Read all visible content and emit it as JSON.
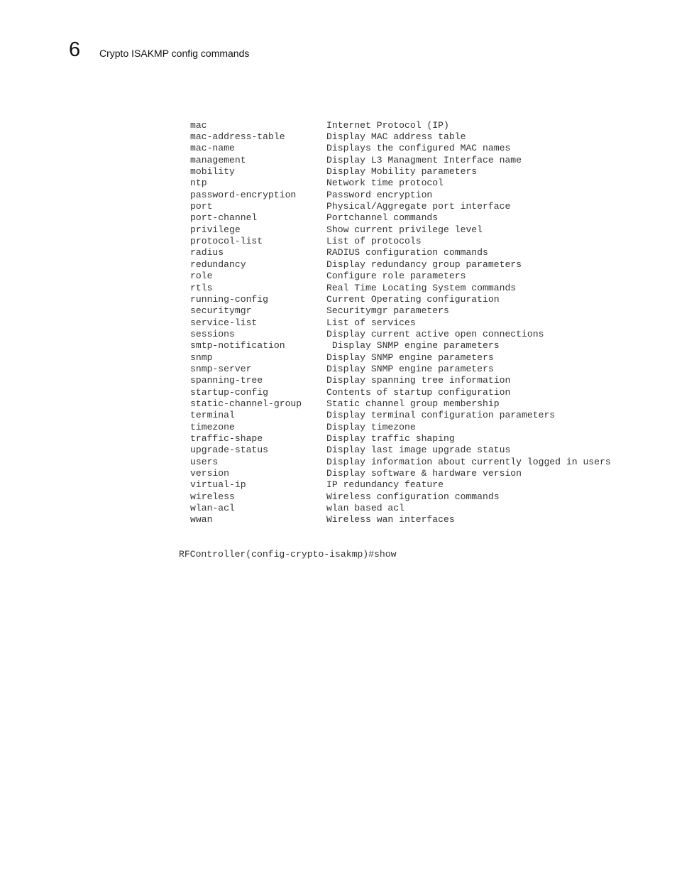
{
  "header": {
    "chapter_number": "6",
    "section_title": "Crypto ISAKMP config commands"
  },
  "cli": {
    "rows": [
      {
        "command": "mac",
        "description": "Internet Protocol (IP)"
      },
      {
        "command": "mac-address-table",
        "description": "Display MAC address table"
      },
      {
        "command": "mac-name",
        "description": "Displays the configured MAC names"
      },
      {
        "command": "management",
        "description": "Display L3 Managment Interface name"
      },
      {
        "command": "mobility",
        "description": "Display Mobility parameters"
      },
      {
        "command": "ntp",
        "description": "Network time protocol"
      },
      {
        "command": "password-encryption",
        "description": "Password encryption"
      },
      {
        "command": "port",
        "description": "Physical/Aggregate port interface"
      },
      {
        "command": "port-channel",
        "description": "Portchannel commands"
      },
      {
        "command": "privilege",
        "description": "Show current privilege level"
      },
      {
        "command": "protocol-list",
        "description": "List of protocols"
      },
      {
        "command": "radius",
        "description": "RADIUS configuration commands"
      },
      {
        "command": "redundancy",
        "description": "Display redundancy group parameters"
      },
      {
        "command": "role",
        "description": "Configure role parameters"
      },
      {
        "command": "rtls",
        "description": "Real Time Locating System commands"
      },
      {
        "command": "running-config",
        "description": "Current Operating configuration"
      },
      {
        "command": "securitymgr",
        "description": "Securitymgr parameters"
      },
      {
        "command": "service-list",
        "description": "List of services"
      },
      {
        "command": "sessions",
        "description": "Display current active open connections"
      },
      {
        "command": "smtp-notification",
        "description": " Display SNMP engine parameters"
      },
      {
        "command": "snmp",
        "description": "Display SNMP engine parameters"
      },
      {
        "command": "snmp-server",
        "description": "Display SNMP engine parameters"
      },
      {
        "command": "spanning-tree",
        "description": "Display spanning tree information"
      },
      {
        "command": "startup-config",
        "description": "Contents of startup configuration"
      },
      {
        "command": "static-channel-group",
        "description": "Static channel group membership"
      },
      {
        "command": "terminal",
        "description": "Display terminal configuration parameters"
      },
      {
        "command": "timezone",
        "description": "Display timezone"
      },
      {
        "command": "traffic-shape",
        "description": "Display traffic shaping"
      },
      {
        "command": "upgrade-status",
        "description": "Display last image upgrade status"
      },
      {
        "command": "users",
        "description": "Display information about currently logged in users"
      },
      {
        "command": "version",
        "description": "Display software & hardware version"
      },
      {
        "command": "virtual-ip",
        "description": "IP redundancy feature"
      },
      {
        "command": "wireless",
        "description": "Wireless configuration commands"
      },
      {
        "command": "wlan-acl",
        "description": "wlan based acl"
      },
      {
        "command": "wwan",
        "description": "Wireless wan interfaces"
      }
    ],
    "prompt": "RFController(config-crypto-isakmp)#show"
  }
}
